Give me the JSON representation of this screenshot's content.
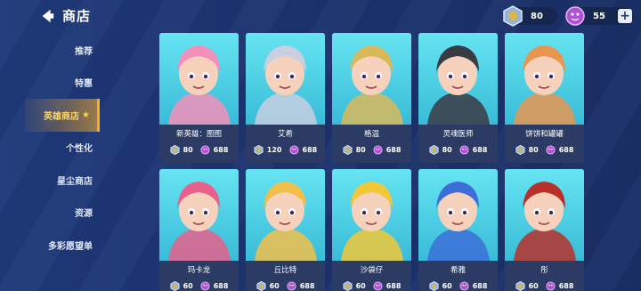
{
  "header": {
    "title": "商店"
  },
  "currency": {
    "gold": "80",
    "gem": "55"
  },
  "sidebar": {
    "items": [
      {
        "label": "推荐"
      },
      {
        "label": "特惠"
      },
      {
        "label": "英雄商店"
      },
      {
        "label": "个性化"
      },
      {
        "label": "星尘商店"
      },
      {
        "label": "资源"
      },
      {
        "label": "多彩愿望单"
      }
    ],
    "active_index": 2
  },
  "heroes": [
    {
      "name": "新英雄：图图",
      "gold": "80",
      "gem": "688",
      "art_color": "#f38fb8"
    },
    {
      "name": "艾希",
      "gold": "120",
      "gem": "688",
      "art_color": "#c7cfe0"
    },
    {
      "name": "格温",
      "gold": "80",
      "gem": "688",
      "art_color": "#d9b85a"
    },
    {
      "name": "灵魂医师",
      "gold": "80",
      "gem": "688",
      "art_color": "#3a3a44"
    },
    {
      "name": "饼饼和罐罐",
      "gold": "80",
      "gem": "688",
      "art_color": "#e89550"
    },
    {
      "name": "玛卡龙",
      "gold": "60",
      "gem": "688",
      "art_color": "#e8608c"
    },
    {
      "name": "丘比特",
      "gold": "60",
      "gem": "688",
      "art_color": "#f2c04a"
    },
    {
      "name": "沙袋仔",
      "gold": "60",
      "gem": "688",
      "art_color": "#f0c838"
    },
    {
      "name": "希雅",
      "gold": "60",
      "gem": "688",
      "art_color": "#3d6ed8"
    },
    {
      "name": "彤",
      "gold": "60",
      "gem": "688",
      "art_color": "#b8302a"
    }
  ],
  "colors": {
    "accent": "#f5b11e",
    "panel": "#2b3b63",
    "art_bg": "#4fd0e6",
    "gem": "#b84fd8",
    "gold": "#7fb0e8"
  }
}
